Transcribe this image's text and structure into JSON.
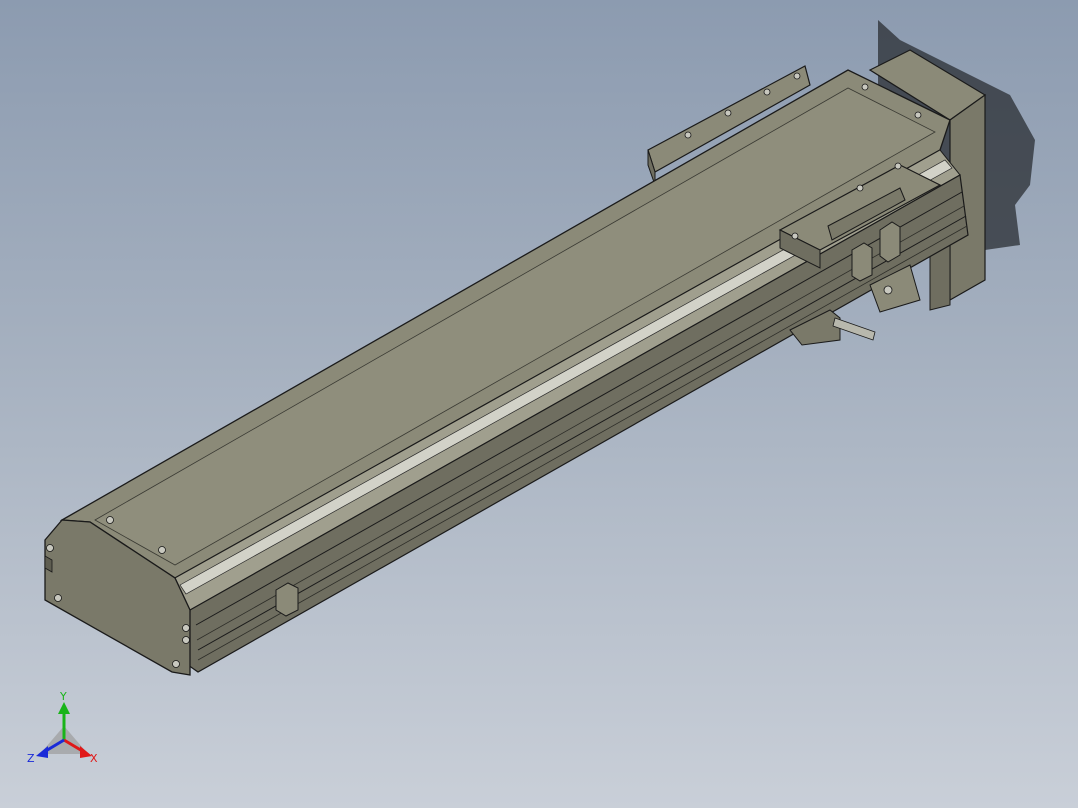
{
  "viewport": {
    "model": "linear-actuator-module",
    "background": {
      "top": "#8c9bb0",
      "bottom": "#c9cfd8"
    },
    "colors": {
      "body_top": "#8b8a78",
      "body_side": "#6f6e60",
      "body_end": "#7a7969",
      "rail": "#c7c7bd",
      "edge": "#1a1a1a",
      "shadow": "#2a2e33"
    }
  },
  "triad": {
    "x_label": "X",
    "y_label": "Y",
    "z_label": "Z",
    "x_color": "#e01818",
    "y_color": "#19b419",
    "z_color": "#1a2ad8"
  }
}
